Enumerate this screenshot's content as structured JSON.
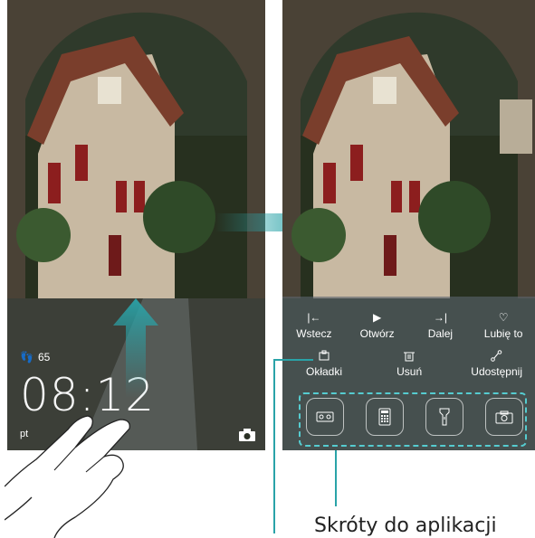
{
  "lockscreen": {
    "steps": "65",
    "time": "08:12",
    "date": "pt"
  },
  "panel": {
    "row1": [
      {
        "label": "Wstecz",
        "icon": "back-icon"
      },
      {
        "label": "Otwórz",
        "icon": "play-icon"
      },
      {
        "label": "Dalej",
        "icon": "forward-icon"
      },
      {
        "label": "Lubię to",
        "icon": "heart-icon"
      }
    ],
    "row2": [
      {
        "label": "Okładki",
        "icon": "cover-icon"
      },
      {
        "label": "Usuń",
        "icon": "trash-icon"
      },
      {
        "label": "Udostępnij",
        "icon": "share-icon"
      }
    ],
    "shortcuts": [
      "recorder-icon",
      "calculator-icon",
      "flashlight-icon",
      "camera-icon"
    ]
  },
  "caption": "Skróty do aplikacji",
  "colors": {
    "accent": "#2aa3a8",
    "dashed": "#55ccd0"
  }
}
